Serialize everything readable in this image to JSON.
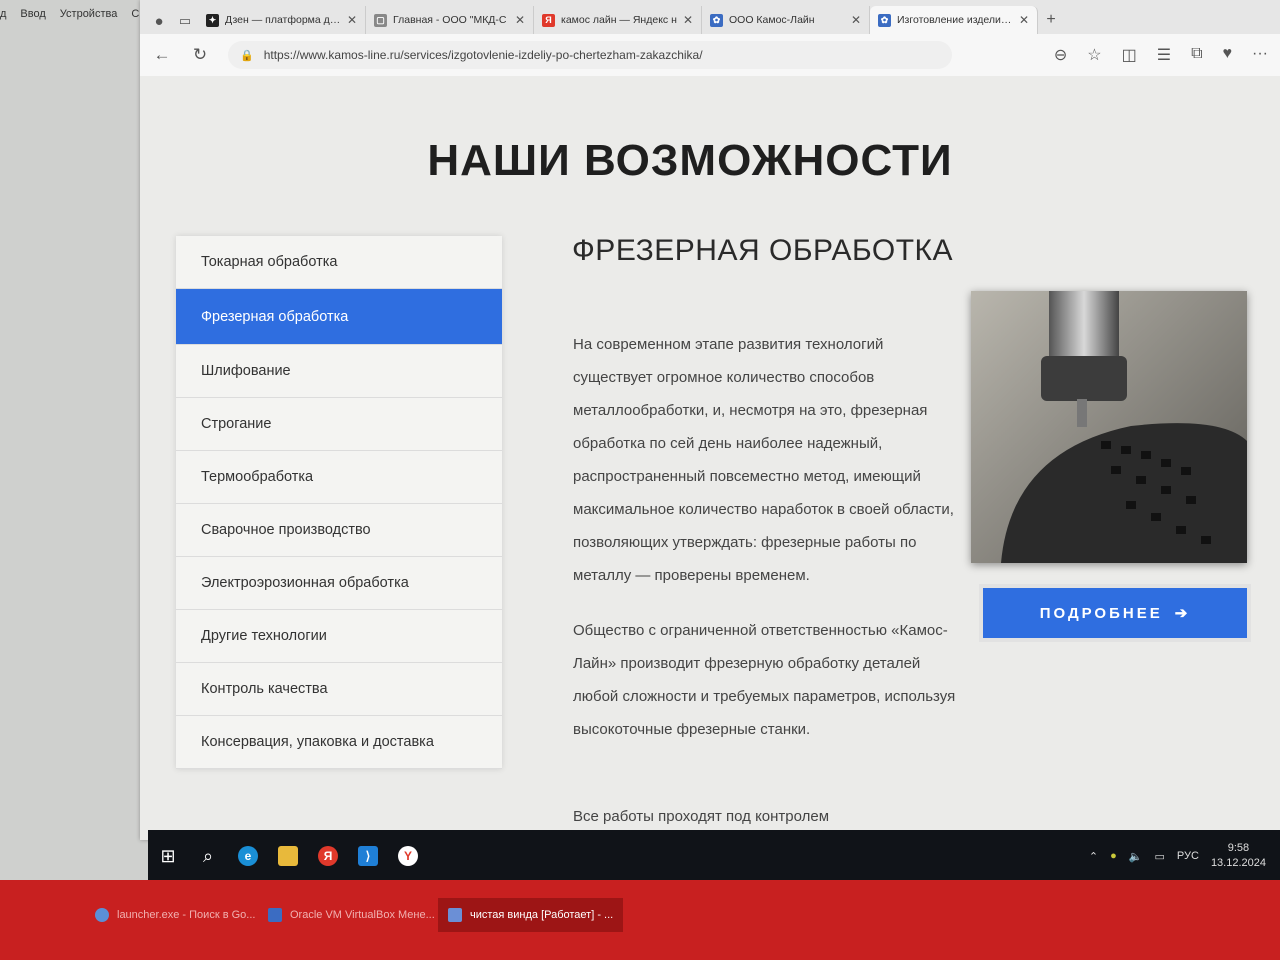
{
  "vm_menu": [
    "д",
    "Ввод",
    "Устройства",
    "Справка"
  ],
  "browser": {
    "tabs": [
      {
        "label": "Дзен — платформа для",
        "fav_color": "#222222",
        "fav_glyph": "✦"
      },
      {
        "label": "Главная - ООО \"МКД-С",
        "fav_color": "#888888",
        "fav_glyph": "▢"
      },
      {
        "label": "камос лайн — Яндекс н",
        "fav_color": "#e0392b",
        "fav_glyph": "Я"
      },
      {
        "label": "ООО Камос-Лайн",
        "fav_color": "#3b6cc2",
        "fav_glyph": "✿"
      },
      {
        "label": "Изготовление изделий п",
        "fav_color": "#3b6cc2",
        "fav_glyph": "✿"
      }
    ],
    "url": "https://www.kamos-line.ru/services/izgotovlenie-izdeliy-po-chertezham-zakazchika/"
  },
  "page": {
    "title": "НАШИ ВОЗМОЖНОСТИ",
    "menu": [
      "Токарная обработка",
      "Фрезерная обработка",
      "Шлифование",
      "Строгание",
      "Термообработка",
      "Сварочное производство",
      "Электроэрозионная обработка",
      "Другие технологии",
      "Контроль качества",
      "Консервация, упаковка и доставка"
    ],
    "active_menu_index": 1,
    "section_title": "ФРЕЗЕРНАЯ ОБРАБОТКА",
    "paragraphs": [
      "На современном этапе развития технологий существует огромное количество способов металлообработки, и, несмотря на это, фрезерная обработка по сей день наиболее надежный, распространенный повсеместно метод, имеющий максимальное количество наработок в своей области, позволяющих утверждать: фрезерные работы по металлу — проверены временем.",
      "Общество с ограниченной ответственностью «Камос-Лайн» производит фрезерную обработку деталей любой сложности и требуемых параметров, используя высокоточные фрезерные станки.",
      "Все работы проходят под контролем"
    ],
    "more_button": "ПОДРОБНЕЕ",
    "accent_color": "#2f6ee0"
  },
  "taskbar": {
    "tray_lang": "РУС",
    "time": "9:58",
    "date": "13.12.2024"
  },
  "host_taskbar": {
    "tasks": [
      {
        "label": "launcher.exe - Поиск в Go..."
      },
      {
        "label": "Oracle VM VirtualBox Мене..."
      },
      {
        "label": "чистая винда [Работает] - ..."
      }
    ]
  }
}
